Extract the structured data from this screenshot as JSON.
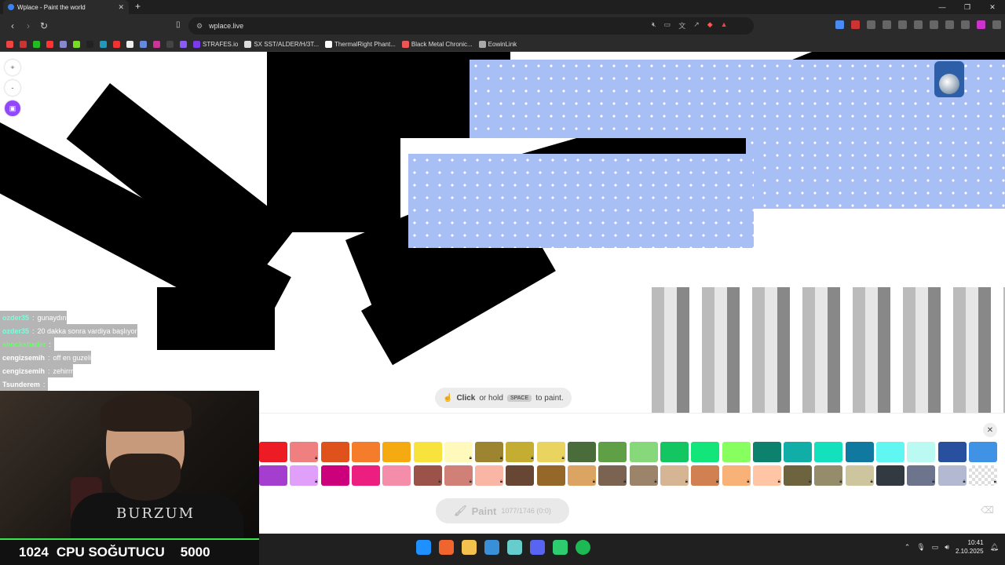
{
  "browser": {
    "tab_title": "Wplace - Paint the world",
    "url": "wplace.live",
    "new_tab": "+",
    "window_controls": [
      "—",
      "❐",
      "✕"
    ]
  },
  "bookmarks": [
    {
      "label": "",
      "color": "#e44"
    },
    {
      "label": "",
      "color": "#c33"
    },
    {
      "label": "",
      "color": "#2b2"
    },
    {
      "label": "",
      "color": "#f33"
    },
    {
      "label": "",
      "color": "#88c"
    },
    {
      "label": "",
      "color": "#7d2"
    },
    {
      "label": "",
      "color": "#222"
    },
    {
      "label": "",
      "color": "#29b"
    },
    {
      "label": "",
      "color": "#e33"
    },
    {
      "label": "",
      "color": "#eee"
    },
    {
      "label": "",
      "color": "#68d"
    },
    {
      "label": "",
      "color": "#c39"
    },
    {
      "label": "",
      "color": "#444"
    },
    {
      "label": "",
      "color": "#8a5cf6"
    },
    {
      "label": "STRAFES.io",
      "color": "#7c3aed"
    },
    {
      "label": "SX SST/ALDER/H/3T...",
      "color": "#ddd"
    },
    {
      "label": "ThermalRight Phant...",
      "color": "#fff"
    },
    {
      "label": "Black Metal Chronic...",
      "color": "#e55"
    },
    {
      "label": "EowinLink",
      "color": "#aaa"
    }
  ],
  "canvas": {
    "hint_click": "Click",
    "hint_or_hold": "or hold",
    "hint_key": "SPACE",
    "hint_to_paint": "to paint.",
    "zoom_in": "+",
    "zoom_out": "-"
  },
  "chat": [
    {
      "user": "ozder35",
      "message": "gunaydın",
      "color": "#7fd"
    },
    {
      "user": "ozder35",
      "message": "20 dakka sonra vardiya başlıyor",
      "color": "#7fd"
    },
    {
      "user": "shockshader",
      "message": "",
      "color": "#6f6"
    },
    {
      "user": "cengizsemih",
      "message": "off en guzeli",
      "color": "#fff"
    },
    {
      "user": "cengizsemih",
      "message": "zehirrr",
      "color": "#fff"
    },
    {
      "user": "Tsunderem",
      "message": "",
      "color": "#fff"
    }
  ],
  "palette": {
    "row1": [
      "#ed1c24",
      "#f08080",
      "#e0521c",
      "#f57c2a",
      "#f6aa12",
      "#f8e23c",
      "#fffabc",
      "#9c8431",
      "#c5ad31",
      "#e8d45f",
      "#4a6b3a",
      "#5fa046",
      "#87d87a",
      "#13c662",
      "#12e67b",
      "#87ff5e",
      "#0c816e",
      "#10ae a6",
      "#13e1be",
      "#0f799f",
      "#60f7f2",
      "#bbfaf2",
      "#28509e",
      "#4093e4"
    ],
    "row2": [
      "#a33ecf",
      "#e09ff9",
      "#cb007a",
      "#ec1f80",
      "#f38da9",
      "#9b5249",
      "#d18078",
      "#fab6a4",
      "#684634",
      "#95682a",
      "#dba463",
      "#7b6352",
      "#9c846b",
      "#d6b594",
      "#d18051",
      "#f8b277",
      "#ffc5a5",
      "#6d643f",
      "#948c6b",
      "#cdc59e",
      "#333941",
      "#6d758d",
      "#b3b9d1",
      "#cccccc"
    ],
    "locked_row1": [
      false,
      true,
      false,
      false,
      false,
      false,
      true,
      true,
      true,
      true,
      false,
      false,
      false,
      false,
      false,
      false,
      false,
      false,
      false,
      false,
      false,
      false,
      false,
      false
    ],
    "locked_row2": [
      false,
      true,
      false,
      false,
      false,
      true,
      true,
      true,
      false,
      false,
      true,
      true,
      true,
      true,
      true,
      true,
      true,
      true,
      true,
      true,
      true,
      true,
      true,
      true
    ],
    "paint_label": "Paint",
    "paint_count": "1077/1746 (0:0)",
    "close": "✕"
  },
  "stream": {
    "banner_count": "1024",
    "banner_text": "CPU SOĞUTUCU",
    "banner_goal": "5000",
    "shirt_text": "BURZUM"
  },
  "taskbar": {
    "time": "10:41",
    "date": "2.10.2025"
  }
}
